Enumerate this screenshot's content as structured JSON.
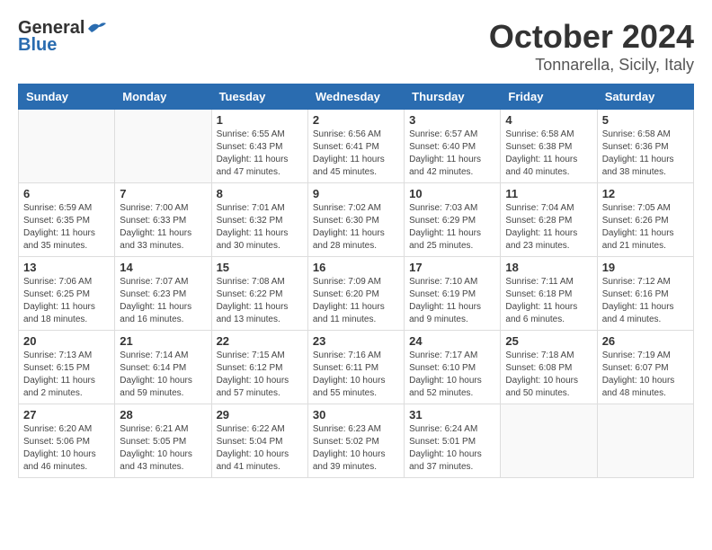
{
  "header": {
    "logo_general": "General",
    "logo_blue": "Blue",
    "title": "October 2024",
    "subtitle": "Tonnarella, Sicily, Italy"
  },
  "columns": [
    "Sunday",
    "Monday",
    "Tuesday",
    "Wednesday",
    "Thursday",
    "Friday",
    "Saturday"
  ],
  "weeks": [
    [
      {
        "day": "",
        "info": ""
      },
      {
        "day": "",
        "info": ""
      },
      {
        "day": "1",
        "info": "Sunrise: 6:55 AM\nSunset: 6:43 PM\nDaylight: 11 hours and 47 minutes."
      },
      {
        "day": "2",
        "info": "Sunrise: 6:56 AM\nSunset: 6:41 PM\nDaylight: 11 hours and 45 minutes."
      },
      {
        "day": "3",
        "info": "Sunrise: 6:57 AM\nSunset: 6:40 PM\nDaylight: 11 hours and 42 minutes."
      },
      {
        "day": "4",
        "info": "Sunrise: 6:58 AM\nSunset: 6:38 PM\nDaylight: 11 hours and 40 minutes."
      },
      {
        "day": "5",
        "info": "Sunrise: 6:58 AM\nSunset: 6:36 PM\nDaylight: 11 hours and 38 minutes."
      }
    ],
    [
      {
        "day": "6",
        "info": "Sunrise: 6:59 AM\nSunset: 6:35 PM\nDaylight: 11 hours and 35 minutes."
      },
      {
        "day": "7",
        "info": "Sunrise: 7:00 AM\nSunset: 6:33 PM\nDaylight: 11 hours and 33 minutes."
      },
      {
        "day": "8",
        "info": "Sunrise: 7:01 AM\nSunset: 6:32 PM\nDaylight: 11 hours and 30 minutes."
      },
      {
        "day": "9",
        "info": "Sunrise: 7:02 AM\nSunset: 6:30 PM\nDaylight: 11 hours and 28 minutes."
      },
      {
        "day": "10",
        "info": "Sunrise: 7:03 AM\nSunset: 6:29 PM\nDaylight: 11 hours and 25 minutes."
      },
      {
        "day": "11",
        "info": "Sunrise: 7:04 AM\nSunset: 6:28 PM\nDaylight: 11 hours and 23 minutes."
      },
      {
        "day": "12",
        "info": "Sunrise: 7:05 AM\nSunset: 6:26 PM\nDaylight: 11 hours and 21 minutes."
      }
    ],
    [
      {
        "day": "13",
        "info": "Sunrise: 7:06 AM\nSunset: 6:25 PM\nDaylight: 11 hours and 18 minutes."
      },
      {
        "day": "14",
        "info": "Sunrise: 7:07 AM\nSunset: 6:23 PM\nDaylight: 11 hours and 16 minutes."
      },
      {
        "day": "15",
        "info": "Sunrise: 7:08 AM\nSunset: 6:22 PM\nDaylight: 11 hours and 13 minutes."
      },
      {
        "day": "16",
        "info": "Sunrise: 7:09 AM\nSunset: 6:20 PM\nDaylight: 11 hours and 11 minutes."
      },
      {
        "day": "17",
        "info": "Sunrise: 7:10 AM\nSunset: 6:19 PM\nDaylight: 11 hours and 9 minutes."
      },
      {
        "day": "18",
        "info": "Sunrise: 7:11 AM\nSunset: 6:18 PM\nDaylight: 11 hours and 6 minutes."
      },
      {
        "day": "19",
        "info": "Sunrise: 7:12 AM\nSunset: 6:16 PM\nDaylight: 11 hours and 4 minutes."
      }
    ],
    [
      {
        "day": "20",
        "info": "Sunrise: 7:13 AM\nSunset: 6:15 PM\nDaylight: 11 hours and 2 minutes."
      },
      {
        "day": "21",
        "info": "Sunrise: 7:14 AM\nSunset: 6:14 PM\nDaylight: 10 hours and 59 minutes."
      },
      {
        "day": "22",
        "info": "Sunrise: 7:15 AM\nSunset: 6:12 PM\nDaylight: 10 hours and 57 minutes."
      },
      {
        "day": "23",
        "info": "Sunrise: 7:16 AM\nSunset: 6:11 PM\nDaylight: 10 hours and 55 minutes."
      },
      {
        "day": "24",
        "info": "Sunrise: 7:17 AM\nSunset: 6:10 PM\nDaylight: 10 hours and 52 minutes."
      },
      {
        "day": "25",
        "info": "Sunrise: 7:18 AM\nSunset: 6:08 PM\nDaylight: 10 hours and 50 minutes."
      },
      {
        "day": "26",
        "info": "Sunrise: 7:19 AM\nSunset: 6:07 PM\nDaylight: 10 hours and 48 minutes."
      }
    ],
    [
      {
        "day": "27",
        "info": "Sunrise: 6:20 AM\nSunset: 5:06 PM\nDaylight: 10 hours and 46 minutes."
      },
      {
        "day": "28",
        "info": "Sunrise: 6:21 AM\nSunset: 5:05 PM\nDaylight: 10 hours and 43 minutes."
      },
      {
        "day": "29",
        "info": "Sunrise: 6:22 AM\nSunset: 5:04 PM\nDaylight: 10 hours and 41 minutes."
      },
      {
        "day": "30",
        "info": "Sunrise: 6:23 AM\nSunset: 5:02 PM\nDaylight: 10 hours and 39 minutes."
      },
      {
        "day": "31",
        "info": "Sunrise: 6:24 AM\nSunset: 5:01 PM\nDaylight: 10 hours and 37 minutes."
      },
      {
        "day": "",
        "info": ""
      },
      {
        "day": "",
        "info": ""
      }
    ]
  ]
}
